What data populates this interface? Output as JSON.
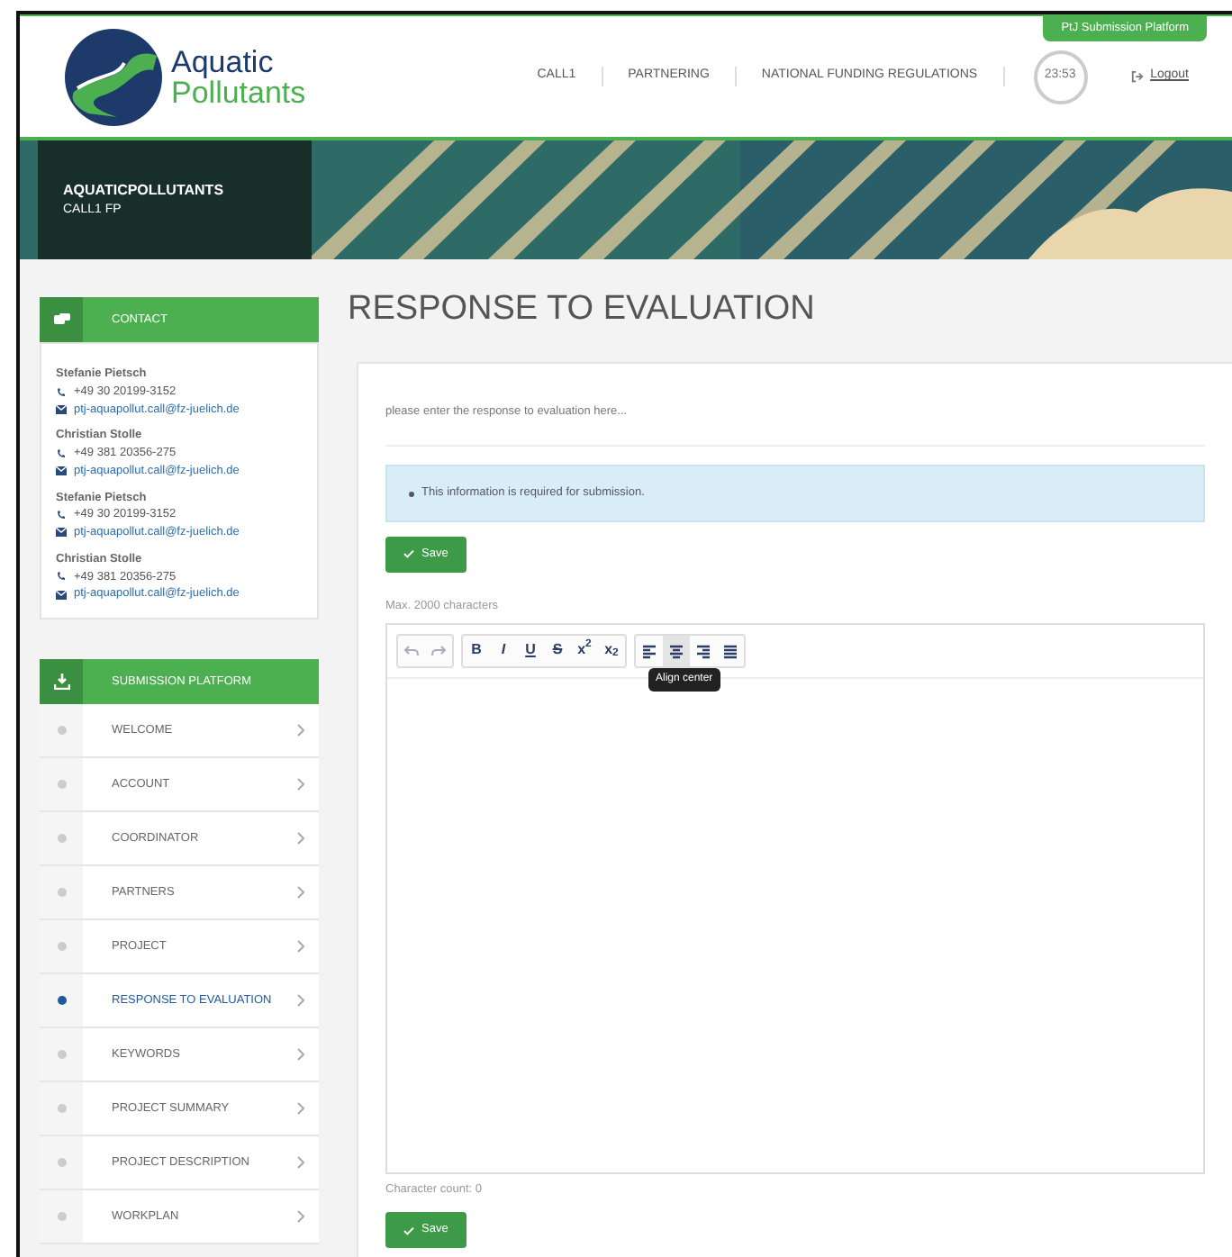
{
  "header": {
    "logo": {
      "line1": "Aquatic",
      "line2": "Pollutants"
    },
    "platform_tab": "PtJ Submission Platform",
    "nav": [
      "CALL1",
      "PARTNERING",
      "NATIONAL FUNDING REGULATIONS"
    ],
    "timer": "23:53",
    "logout": "Logout"
  },
  "banner": {
    "title": "AQUATICPOLLUTANTS",
    "subtitle": "CALL1 FP"
  },
  "contact": {
    "heading": "CONTACT",
    "people": [
      {
        "name": "Stefanie Pietsch",
        "phone": "+49 30 20199-3152",
        "email": "ptj-aquapollut.call@fz-juelich.de"
      },
      {
        "name": "Christian Stolle",
        "phone": "+49 381 20356-275",
        "email": "ptj-aquapollut.call@fz-juelich.de"
      },
      {
        "name": "Stefanie Pietsch",
        "phone": "+49 30 20199-3152",
        "email": "ptj-aquapollut.call@fz-juelich.de"
      },
      {
        "name": "Christian Stolle",
        "phone": "+49 381 20356-275",
        "email": "ptj-aquapollut.call@fz-juelich.de"
      }
    ]
  },
  "submission": {
    "heading": "SUBMISSION PLATFORM",
    "items": [
      {
        "label": "WELCOME",
        "selected": false
      },
      {
        "label": "ACCOUNT",
        "selected": false
      },
      {
        "label": "COORDINATOR",
        "selected": false
      },
      {
        "label": "PARTNERS",
        "selected": false
      },
      {
        "label": "PROJECT",
        "selected": false
      },
      {
        "label": "RESPONSE TO EVALUATION",
        "selected": true
      },
      {
        "label": "KEYWORDS",
        "selected": false
      },
      {
        "label": "PROJECT SUMMARY",
        "selected": false
      },
      {
        "label": "PROJECT DESCRIPTION",
        "selected": false
      },
      {
        "label": "WORKPLAN",
        "selected": false
      }
    ]
  },
  "main": {
    "title": "RESPONSE TO EVALUATION",
    "field": {
      "placeholder": "please enter the response to evaluation here..."
    },
    "alert": "This information is required for submission.",
    "save_top": "Save",
    "max_note": "Max. 2000 characters",
    "toolbar": [
      [
        {
          "kind": "undo",
          "hovered": false
        },
        {
          "kind": "redo",
          "hovered": false
        }
      ],
      [
        {
          "kind": "text",
          "label": "B",
          "hovered": false
        },
        {
          "kind": "text",
          "label": "I",
          "hovered": false
        },
        {
          "kind": "text",
          "label": "U",
          "hovered": false
        },
        {
          "kind": "text",
          "label": "S",
          "hovered": false
        },
        {
          "kind": "text",
          "label": "x$^{2}$",
          "hovered": false
        },
        {
          "kind": "text",
          "label": "x$_{2}$",
          "hovered": false
        }
      ],
      [
        {
          "kind": "align-left",
          "hovered": false
        },
        {
          "kind": "align-center",
          "hovered": true,
          "tooltip": "Align center"
        },
        {
          "kind": "align-right",
          "hovered": false
        },
        {
          "kind": "justify",
          "hovered": false
        }
      ]
    ],
    "char_count": "Character count: 0",
    "save_bottom": "Save"
  }
}
